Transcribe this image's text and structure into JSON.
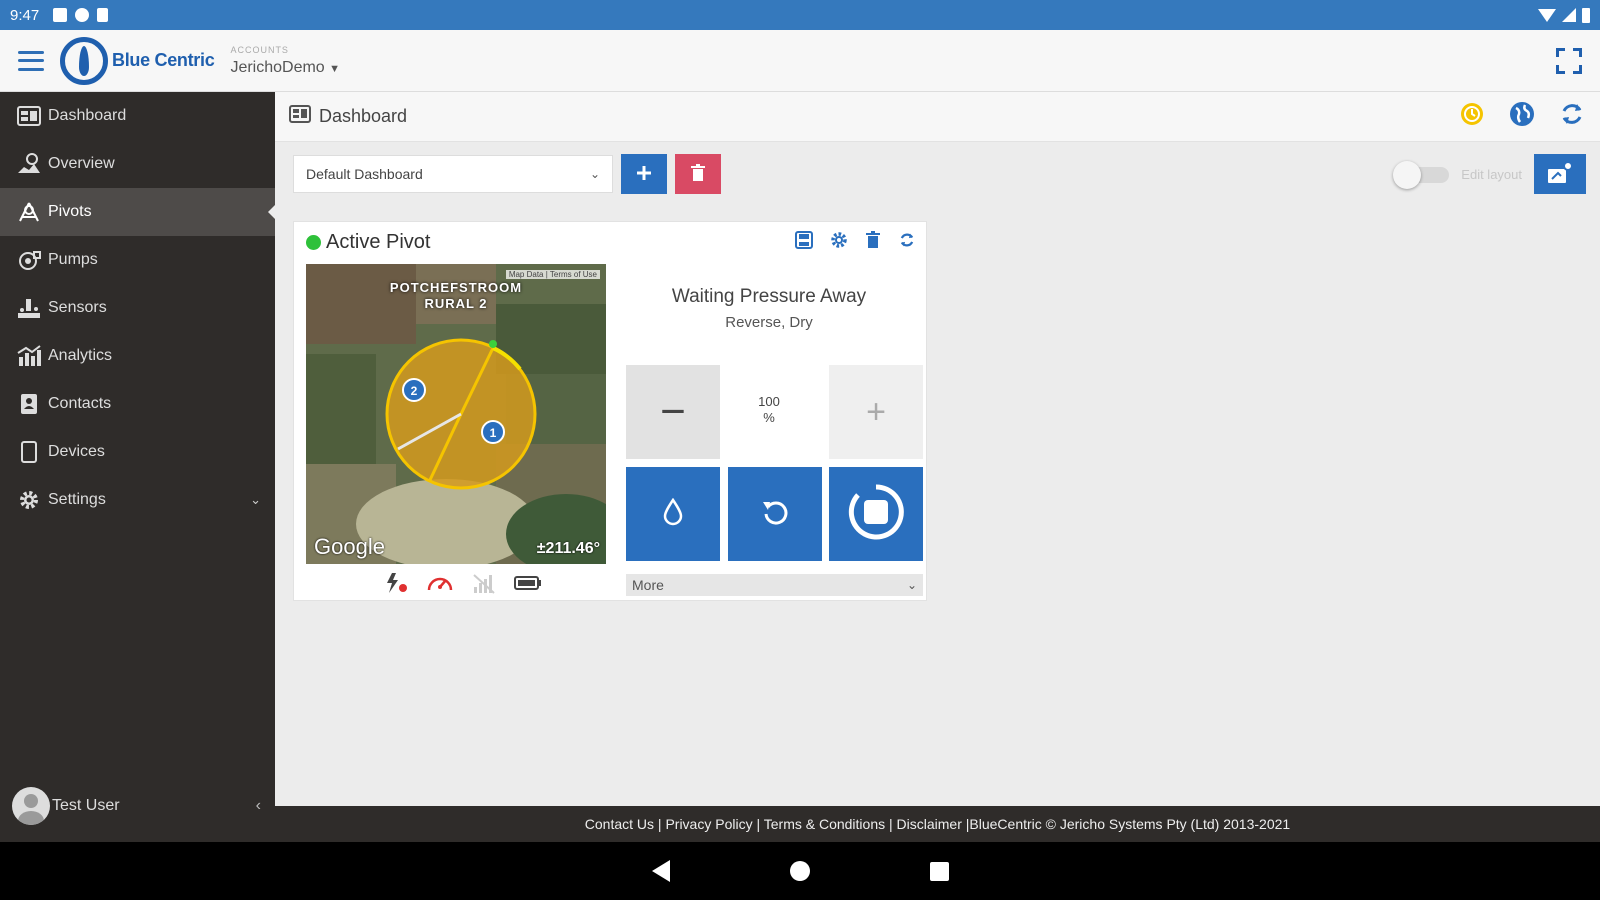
{
  "status_bar": {
    "time": "9:47"
  },
  "app": {
    "brand": "Blue Centric",
    "account_label": "ACCOUNTS",
    "account_name": "JerichoDemo"
  },
  "sidebar": {
    "items": [
      {
        "label": "Dashboard",
        "icon": "dashboard-icon"
      },
      {
        "label": "Overview",
        "icon": "overview-icon"
      },
      {
        "label": "Pivots",
        "icon": "pivot-icon"
      },
      {
        "label": "Pumps",
        "icon": "pump-icon"
      },
      {
        "label": "Sensors",
        "icon": "sensor-icon"
      },
      {
        "label": "Analytics",
        "icon": "analytics-icon"
      },
      {
        "label": "Contacts",
        "icon": "contacts-icon"
      },
      {
        "label": "Devices",
        "icon": "device-icon"
      },
      {
        "label": "Settings",
        "icon": "gear-icon"
      }
    ],
    "active_index": 2,
    "user_name": "Test User"
  },
  "page": {
    "title": "Dashboard",
    "dashboard_select": "Default Dashboard",
    "edit_layout_label": "Edit layout"
  },
  "widget": {
    "title": "Active Pivot",
    "status_color": "#2ec13a",
    "map": {
      "attribution": "Map Data | Terms of Use",
      "place_line1": "POTCHEFSTROOM",
      "place_line2": "RURAL 2",
      "provider": "Google",
      "angle": "±211.46°"
    },
    "state": "Waiting Pressure Away",
    "substate": "Reverse, Dry",
    "speed_value": "100",
    "speed_unit": "%",
    "minus_label": "−",
    "plus_label": "+",
    "more_label": "More"
  },
  "footer": {
    "text": "Contact Us | Privacy Policy | Terms & Conditions | Disclaimer |BlueCentric © Jericho Systems Pty (Ltd) 2013-2021"
  },
  "colors": {
    "brand_blue": "#2a6fbe",
    "status_bar": "#3579bd",
    "sidebar_bg": "#2f2c2a",
    "delete_red": "#d94a64",
    "pivot_yellow": "#f5c400"
  }
}
